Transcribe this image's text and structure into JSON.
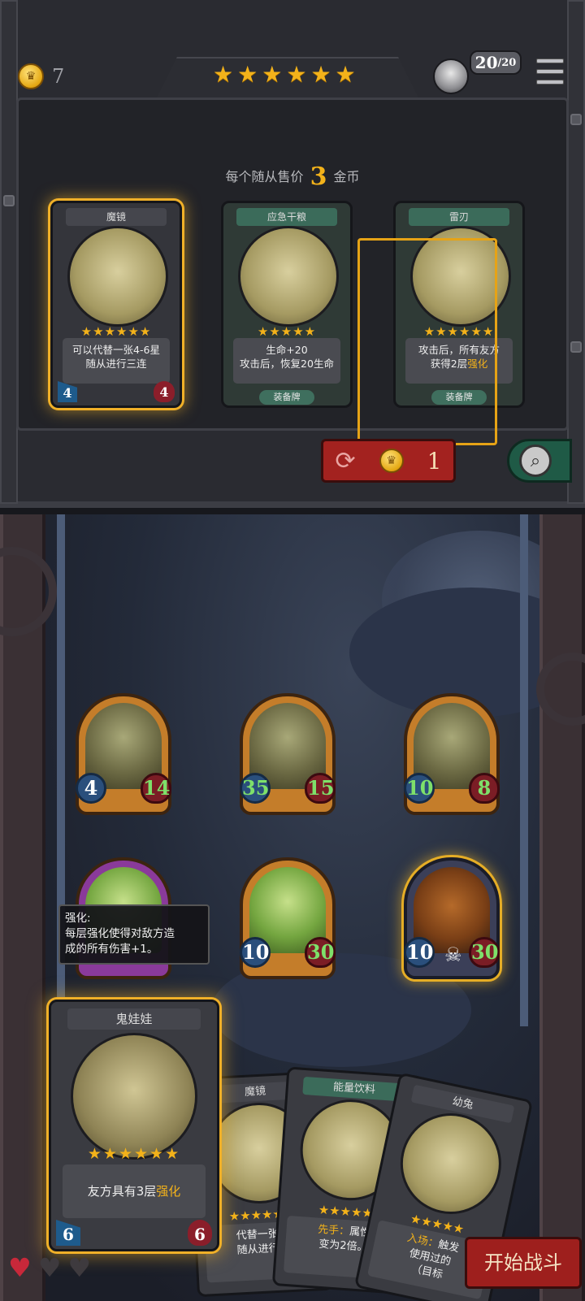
{
  "top_bar": {
    "gold": "7",
    "tier_stars": 6,
    "hp_current": "20",
    "hp_max": "/20",
    "colors": {
      "gold": "#f3b21a",
      "panel": "#2a2b31"
    }
  },
  "shop": {
    "price_prefix": "每个随从售价",
    "price_value": "3",
    "price_suffix": "金币",
    "cards": [
      {
        "title": "魔镜",
        "stars": 6,
        "desc_line1": "可以代替一张4-6星",
        "desc_line2": "随从进行三连",
        "tag": "",
        "attack": "4",
        "health": "4"
      },
      {
        "title": "应急干粮",
        "stars": 5,
        "desc_line1": "生命+20",
        "desc_line2": "攻击后，恢复20生命",
        "tag": "装备牌",
        "attack": "",
        "health": ""
      },
      {
        "title": "雷刃",
        "stars": 6,
        "desc_line1": "攻击后，所有友方",
        "desc_line2_pre": "获得2层",
        "desc_line2_kw": "强化",
        "tag": "装备牌",
        "attack": "",
        "health": ""
      }
    ],
    "refresh_cost": "1",
    "refresh_icon": "refresh-icon",
    "search_icon": "search-icon"
  },
  "board": {
    "units": [
      {
        "name": "swamp-beast",
        "attack": "4",
        "health": "14"
      },
      {
        "name": "swamp-beast",
        "attack": "35",
        "health": "15"
      },
      {
        "name": "swamp-beast",
        "attack": "10",
        "health": "8"
      },
      {
        "name": "purple-frog",
        "attack": "",
        "health": ""
      },
      {
        "name": "tongue-frog",
        "attack": "10",
        "health": "30"
      },
      {
        "name": "pumpkin-monster",
        "attack": "10",
        "health": "30"
      }
    ],
    "tooltip_line1": "强化:",
    "tooltip_line2": "每层强化使得对敌方造",
    "tooltip_line3": "成的所有伤害+1。"
  },
  "hand": {
    "featured": {
      "title": "鬼娃娃",
      "stars": 6,
      "desc_pre": "友方具有3层",
      "desc_kw": "强化",
      "attack": "6",
      "health": "6"
    },
    "cards": [
      {
        "title": "魔镜",
        "desc_line1": "代替一张4-",
        "desc_line2": "随从进行三"
      },
      {
        "title": "能量饮料",
        "desc_line1_pre": "先手：",
        "desc_line1": "属性",
        "desc_line2": "变为2倍。"
      },
      {
        "title": "幼兔",
        "desc_line1_pre": "入场：",
        "desc_line1": "触发",
        "desc_line2": "使用过的",
        "desc_line3": "（目标"
      }
    ]
  },
  "footer": {
    "lives_full": 1,
    "lives_empty": 2,
    "start_label": "开始战斗"
  }
}
